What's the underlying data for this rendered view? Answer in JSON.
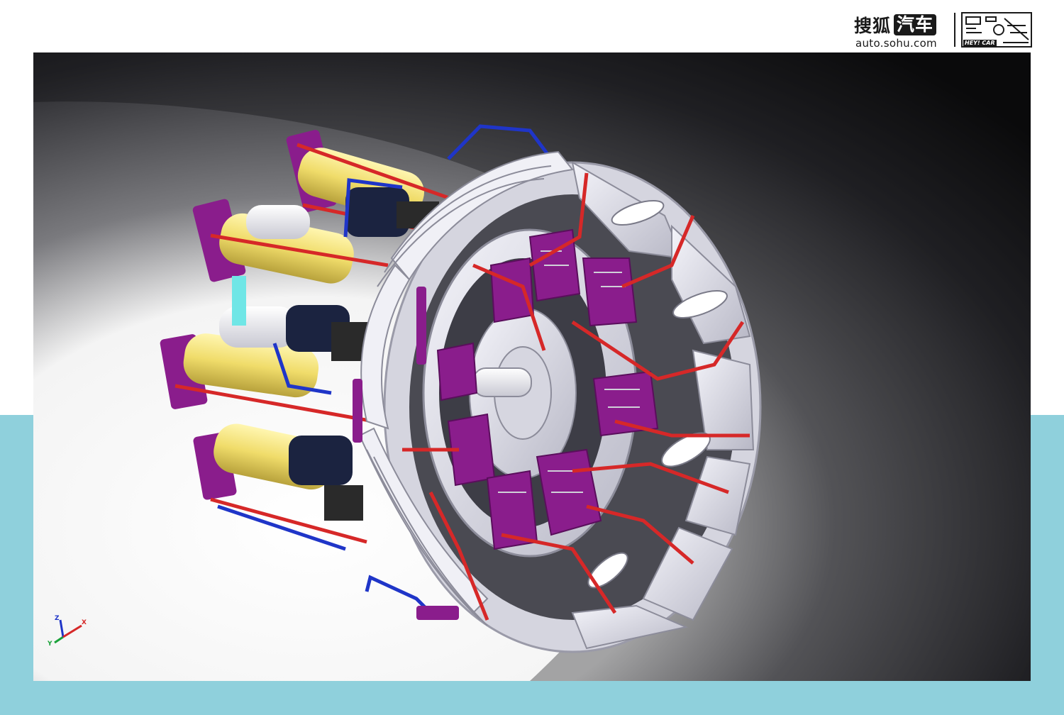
{
  "header": {
    "brand_sohu": "搜狐",
    "brand_car": "汽车",
    "domain": "auto.sohu.com",
    "partner_logo_text": "HEY! CAR"
  },
  "viewer": {
    "axis_x": "X",
    "axis_y": "Y",
    "axis_z": "Z"
  },
  "colors": {
    "teal_background": "#8fd0dc",
    "wire_red": "#d62828",
    "wire_blue": "#1f35c8",
    "bracket_purple": "#8a1d8c",
    "coil_yellow": "#f2e27a",
    "housing_gray": "#dcdce6"
  }
}
